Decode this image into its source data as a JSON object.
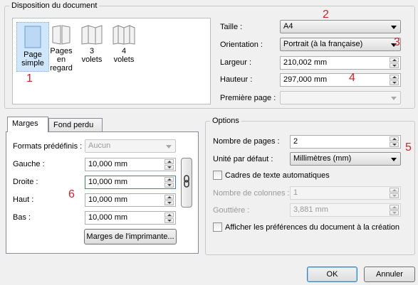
{
  "disposition": {
    "title": "Disposition du document",
    "layouts": [
      {
        "label_lines": [
          "Page",
          "simple"
        ],
        "selected": true
      },
      {
        "label_lines": [
          "Pages",
          "en",
          "regard"
        ],
        "selected": false
      },
      {
        "label_lines": [
          "3",
          "volets"
        ],
        "selected": false
      },
      {
        "label_lines": [
          "4",
          "volets"
        ],
        "selected": false
      }
    ],
    "taille_label": "Taille :",
    "taille_value": "A4",
    "orientation_label": "Orientation :",
    "orientation_value": "Portrait (à la française)",
    "largeur_label": "Largeur :",
    "largeur_value": "210,002 mm",
    "hauteur_label": "Hauteur :",
    "hauteur_value": "297,000 mm",
    "premiere_page_label": "Première page :",
    "premiere_page_value": ""
  },
  "tabs": [
    {
      "label": "Marges",
      "active": true
    },
    {
      "label": "Fond perdu",
      "active": false
    }
  ],
  "marges": {
    "formats_label": "Formats prédéfinis :",
    "formats_value": "Aucun",
    "gauche_label": "Gauche :",
    "gauche_value": "10,000 mm",
    "droite_label": "Droite :",
    "droite_value": "10,000 mm",
    "haut_label": "Haut :",
    "haut_value": "10,000 mm",
    "bas_label": "Bas :",
    "bas_value": "10,000 mm",
    "printer_button": "Marges de l'imprimante..."
  },
  "options": {
    "title": "Options",
    "nombre_pages_label": "Nombre de pages :",
    "nombre_pages_value": "2",
    "unite_label": "Unité par défaut :",
    "unite_value": "Millimètres (mm)",
    "cadres_label": "Cadres de texte automatiques",
    "cadres_checked": false,
    "colonnes_label": "Nombre de colonnes :",
    "colonnes_value": "1",
    "gouttiere_label": "Gouttière :",
    "gouttiere_value": "3,881 mm",
    "afficher_label": "Afficher les préférences du document à la création",
    "afficher_checked": false
  },
  "buttons": {
    "ok": "OK",
    "cancel": "Annuler"
  },
  "annotations": [
    "1",
    "2",
    "3",
    "4",
    "5",
    "6"
  ],
  "colors": {
    "annotation": "#d0202a",
    "selected_tile": "#cfe6fb",
    "page_icon_selected": "#bcd8f5"
  },
  "icons": [
    "single-page-icon",
    "facing-pages-icon",
    "three-fold-icon",
    "four-fold-icon",
    "chain-link-icon"
  ]
}
